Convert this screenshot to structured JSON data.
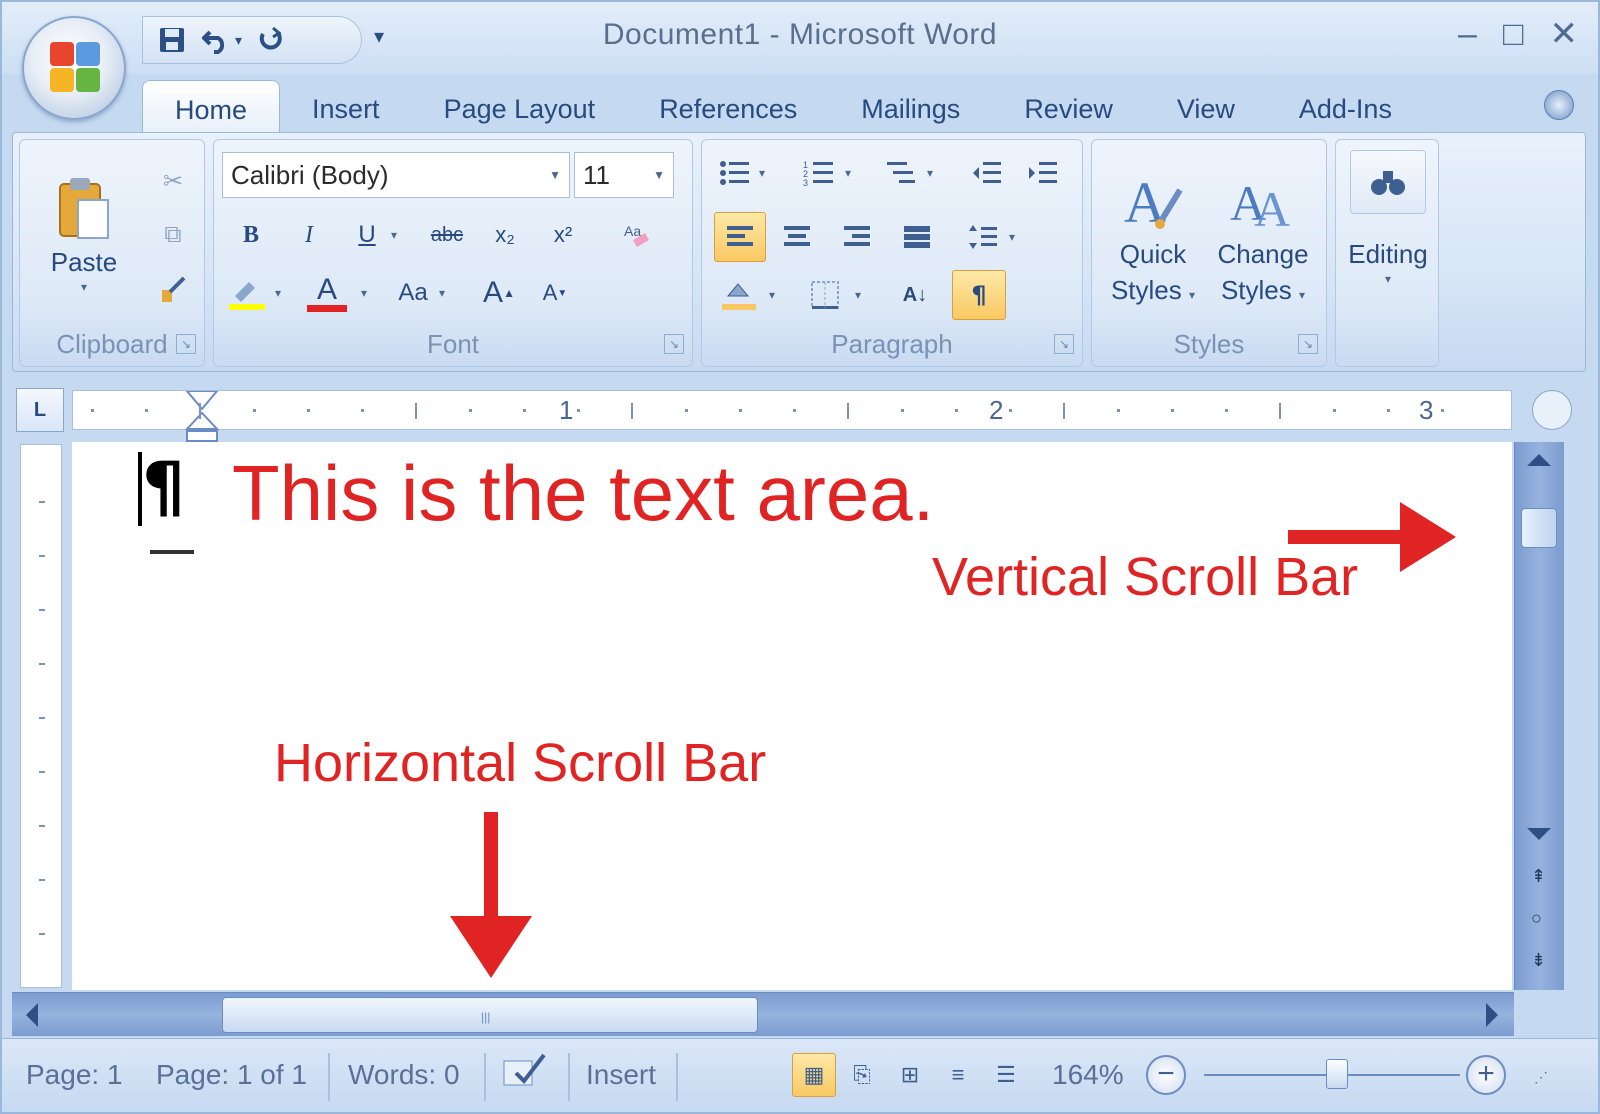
{
  "window": {
    "title": "Document1 - Microsoft Word",
    "controls": {
      "minimize": "–",
      "maximize": "□",
      "close": "✕"
    }
  },
  "quick_access": {
    "save_icon": "save-icon",
    "undo_icon": "undo-icon",
    "redo_icon": "redo-icon",
    "customize_icon": "chevron-down-icon"
  },
  "tabs": [
    {
      "label": "Home",
      "active": true
    },
    {
      "label": "Insert",
      "active": false
    },
    {
      "label": "Page Layout",
      "active": false
    },
    {
      "label": "References",
      "active": false
    },
    {
      "label": "Mailings",
      "active": false
    },
    {
      "label": "Review",
      "active": false
    },
    {
      "label": "View",
      "active": false
    },
    {
      "label": "Add-Ins",
      "active": false
    }
  ],
  "ribbon": {
    "clipboard": {
      "label": "Clipboard",
      "paste_label": "Paste"
    },
    "font": {
      "label": "Font",
      "font_name": "Calibri (Body)",
      "font_size": "11",
      "bold": "B",
      "italic": "I",
      "underline": "U",
      "strikethrough": "abc",
      "subscript": "x₂",
      "superscript": "x²",
      "change_case": "Aa",
      "grow_font": "A",
      "shrink_font": "A",
      "font_color": "#e02323"
    },
    "paragraph": {
      "label": "Paragraph",
      "show_hide": "¶",
      "sort": "A↓",
      "highlight_color": "#f9c863"
    },
    "styles": {
      "label": "Styles",
      "quick_styles_line1": "Quick",
      "quick_styles_line2": "Styles",
      "change_styles_line1": "Change",
      "change_styles_line2": "Styles"
    },
    "editing": {
      "label": "Editing"
    }
  },
  "ruler": {
    "numbers": [
      "1",
      "2",
      "3"
    ]
  },
  "document": {
    "annotation_main": "This is the text area.",
    "annotation_vertical": "Vertical Scroll Bar",
    "annotation_horizontal": "Horizontal Scroll Bar",
    "annotation_color": "#e02323"
  },
  "statusbar": {
    "page": "Page: 1",
    "page_of": "Page: 1 of 1",
    "words": "Words: 0",
    "mode": "Insert",
    "zoom": "164%"
  }
}
